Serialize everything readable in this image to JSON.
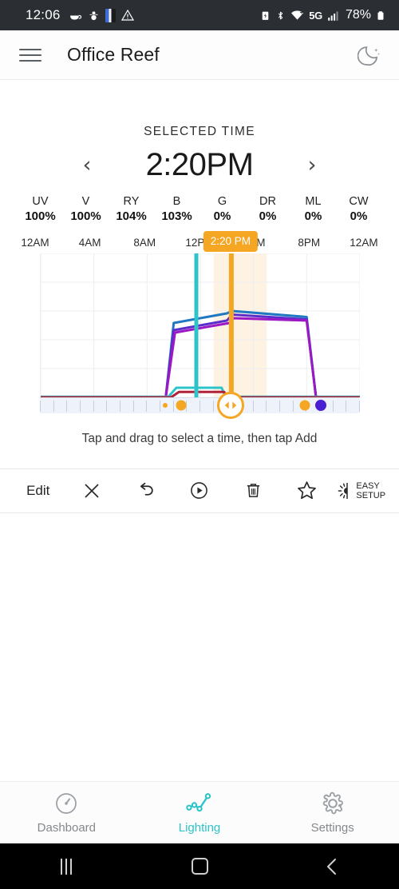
{
  "statusbar": {
    "clock": "12:06",
    "network_label": "5G",
    "battery_percent": "78%",
    "icons": [
      "coffee-icon",
      "snowman-icon",
      "picture-icon",
      "warning-icon",
      "battery-saver-icon",
      "bluetooth-icon",
      "wifi-icon",
      "signal-icon",
      "battery-icon"
    ]
  },
  "appbar": {
    "menu_icon": "hamburger-menu-icon",
    "title": "Office Reef",
    "night_icon": "moon-icon"
  },
  "selected_time": {
    "label": "SELECTED TIME",
    "prev": "‹",
    "value": "2:20PM",
    "next": "›"
  },
  "channels": [
    {
      "name": "UV",
      "value": "100%"
    },
    {
      "name": "V",
      "value": "100%"
    },
    {
      "name": "RY",
      "value": "104%"
    },
    {
      "name": "B",
      "value": "103%"
    },
    {
      "name": "G",
      "value": "0%"
    },
    {
      "name": "DR",
      "value": "0%"
    },
    {
      "name": "ML",
      "value": "0%"
    },
    {
      "name": "CW",
      "value": "0%"
    }
  ],
  "chart_data": {
    "type": "line",
    "title": "",
    "xlabel": "",
    "ylabel": "",
    "x_tick_labels": [
      "12AM",
      "4AM",
      "8AM",
      "12PM",
      "4PM",
      "8PM",
      "12AM"
    ],
    "x_tick_hours": [
      0,
      4,
      8,
      12,
      16,
      20,
      24
    ],
    "xlim": [
      0,
      24
    ],
    "ylim": [
      0,
      120
    ],
    "grid": true,
    "legend_position": "none",
    "selection_badge": "2:20 PM",
    "selection_hour": 14.333,
    "selection_band": [
      13.0,
      17.0
    ],
    "cursor_hour": 11.7,
    "series": [
      {
        "name": "B",
        "color": "#1f78c1",
        "x": [
          0,
          9.4,
          10.0,
          14.0,
          14.4,
          20.0,
          20.7,
          24
        ],
        "y": [
          0,
          0,
          62,
          70,
          72,
          67,
          0,
          0
        ]
      },
      {
        "name": "RY",
        "color": "#5b2ecc",
        "x": [
          0,
          9.4,
          10.0,
          14.0,
          14.4,
          20.0,
          20.7,
          24
        ],
        "y": [
          0,
          0,
          56,
          64,
          69,
          65,
          0,
          0
        ]
      },
      {
        "name": "V",
        "color": "#9b18c4",
        "x": [
          0,
          9.4,
          10.1,
          14.2,
          14.5,
          20.0,
          20.7,
          24
        ],
        "y": [
          0,
          0,
          54,
          62,
          66,
          64,
          0,
          0
        ]
      },
      {
        "name": "UV",
        "color": "#2dc4c9",
        "x": [
          0,
          9.6,
          10.2,
          13.6,
          13.9,
          24
        ],
        "y": [
          0.5,
          0.5,
          8,
          8,
          0.5,
          0.5
        ]
      },
      {
        "name": "DR",
        "color": "#b0213a",
        "x": [
          0,
          9.8,
          10.4,
          13.8,
          14.0,
          24
        ],
        "y": [
          0,
          0,
          4.5,
          4.5,
          0,
          0
        ]
      }
    ],
    "scrubber_markers": [
      {
        "hour": 9.4,
        "color": "#f5a623",
        "size": 6,
        "name": "ramp-start-marker"
      },
      {
        "hour": 10.6,
        "color": "#f5a623",
        "size": 13,
        "name": "sunrise-marker"
      },
      {
        "hour": 19.9,
        "color": "#f5a623",
        "size": 13,
        "name": "sunset-marker"
      },
      {
        "hour": 21.1,
        "color": "#4a1fd1",
        "size": 14,
        "name": "moon-marker"
      }
    ],
    "handle_hour": 14.333
  },
  "hint": "Tap and drag to select a time, then tap Add",
  "toolbar": {
    "edit_label": "Edit",
    "items": [
      {
        "name": "edit-button",
        "icon": "text"
      },
      {
        "name": "close-button",
        "icon": "close-icon"
      },
      {
        "name": "undo-button",
        "icon": "undo-icon"
      },
      {
        "name": "play-button",
        "icon": "play-circle-icon"
      },
      {
        "name": "delete-button",
        "icon": "trash-icon"
      },
      {
        "name": "favorite-button",
        "icon": "star-icon"
      },
      {
        "name": "easy-setup-button",
        "icon": "half-sun-icon"
      }
    ],
    "easy_setup_line1": "EASY",
    "easy_setup_line2": "SETUP"
  },
  "bottomnav": {
    "active": "Lighting",
    "items": [
      {
        "label": "Dashboard",
        "icon": "gauge-icon",
        "active": false
      },
      {
        "label": "Lighting",
        "icon": "linechart-icon",
        "active": true
      },
      {
        "label": "Settings",
        "icon": "gear-icon",
        "active": false
      }
    ]
  },
  "androidnav": {
    "recents": "recents-icon",
    "home": "home-icon",
    "back": "back-icon"
  },
  "colors": {
    "accent": "#2dc4c9",
    "highlight": "#f5a623",
    "statusbar_bg": "#2b2f34"
  }
}
